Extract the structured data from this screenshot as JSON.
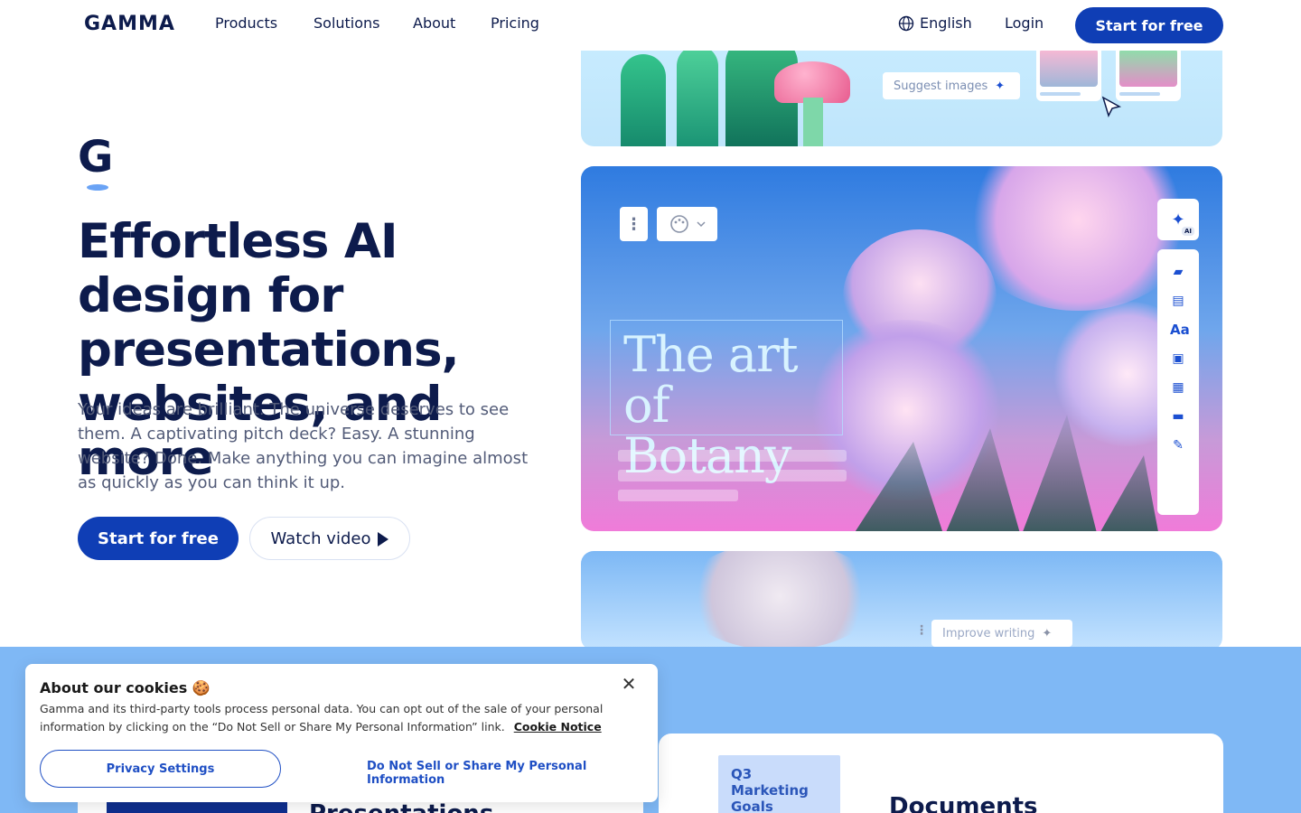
{
  "nav": {
    "logo": "GAMMA",
    "links": [
      "Products",
      "Solutions",
      "About",
      "Pricing"
    ],
    "language": "English",
    "login": "Login",
    "cta": "Start for free"
  },
  "hero": {
    "headline": "Effortless AI design for presentations, websites, and more",
    "subtext": "Your ideas are brilliant. The universe deserves to see them. A captivating pitch deck? Easy. A stunning website? Done. Make anything you can imagine almost as quickly as you can think it up.",
    "primary_cta": "Start for free",
    "secondary_cta": "Watch video"
  },
  "showcase": {
    "suggest_images": "Suggest images",
    "art_title_line1": "The art",
    "art_title_line2": "of Botany",
    "ai_badge": "AI",
    "improve_writing": "Improve writing"
  },
  "products": {
    "doc_card_title": "Q3 Marketing Goals",
    "documents": "Documents",
    "presentations": "Presentations"
  },
  "cookie": {
    "title": "About our cookies 🍪",
    "text": "Gamma and its third-party tools process personal data. You can opt out of the sale of your personal information by clicking on the “Do Not Sell or Share My Personal Information” link.",
    "notice_link": "Cookie Notice",
    "privacy_button": "Privacy Settings",
    "do_not_sell": "Do Not Sell or Share My Personal Information"
  },
  "colors": {
    "brand_blue": "#0f3eb5",
    "navy_text": "#0d1b4c",
    "band_blue": "#7fb8f5"
  }
}
